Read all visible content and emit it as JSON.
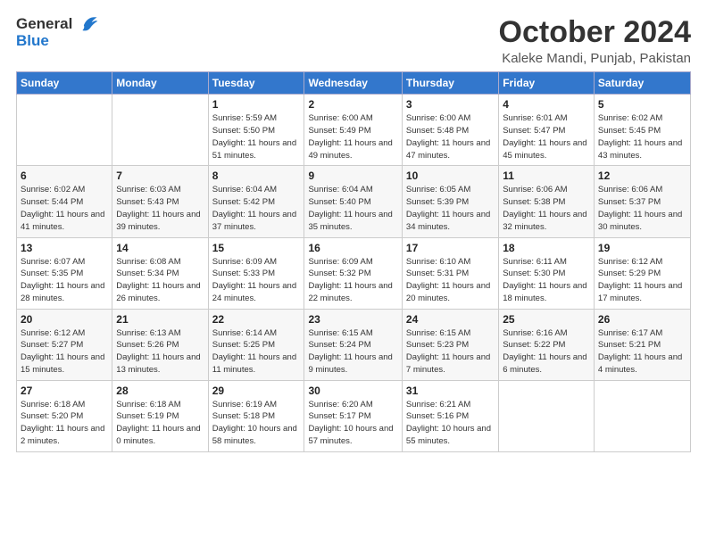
{
  "logo": {
    "general": "General",
    "blue": "Blue"
  },
  "title": "October 2024",
  "subtitle": "Kaleke Mandi, Punjab, Pakistan",
  "weekdays": [
    "Sunday",
    "Monday",
    "Tuesday",
    "Wednesday",
    "Thursday",
    "Friday",
    "Saturday"
  ],
  "weeks": [
    [
      {
        "day": "",
        "info": ""
      },
      {
        "day": "",
        "info": ""
      },
      {
        "day": "1",
        "info": "Sunrise: 5:59 AM\nSunset: 5:50 PM\nDaylight: 11 hours and 51 minutes."
      },
      {
        "day": "2",
        "info": "Sunrise: 6:00 AM\nSunset: 5:49 PM\nDaylight: 11 hours and 49 minutes."
      },
      {
        "day": "3",
        "info": "Sunrise: 6:00 AM\nSunset: 5:48 PM\nDaylight: 11 hours and 47 minutes."
      },
      {
        "day": "4",
        "info": "Sunrise: 6:01 AM\nSunset: 5:47 PM\nDaylight: 11 hours and 45 minutes."
      },
      {
        "day": "5",
        "info": "Sunrise: 6:02 AM\nSunset: 5:45 PM\nDaylight: 11 hours and 43 minutes."
      }
    ],
    [
      {
        "day": "6",
        "info": "Sunrise: 6:02 AM\nSunset: 5:44 PM\nDaylight: 11 hours and 41 minutes."
      },
      {
        "day": "7",
        "info": "Sunrise: 6:03 AM\nSunset: 5:43 PM\nDaylight: 11 hours and 39 minutes."
      },
      {
        "day": "8",
        "info": "Sunrise: 6:04 AM\nSunset: 5:42 PM\nDaylight: 11 hours and 37 minutes."
      },
      {
        "day": "9",
        "info": "Sunrise: 6:04 AM\nSunset: 5:40 PM\nDaylight: 11 hours and 35 minutes."
      },
      {
        "day": "10",
        "info": "Sunrise: 6:05 AM\nSunset: 5:39 PM\nDaylight: 11 hours and 34 minutes."
      },
      {
        "day": "11",
        "info": "Sunrise: 6:06 AM\nSunset: 5:38 PM\nDaylight: 11 hours and 32 minutes."
      },
      {
        "day": "12",
        "info": "Sunrise: 6:06 AM\nSunset: 5:37 PM\nDaylight: 11 hours and 30 minutes."
      }
    ],
    [
      {
        "day": "13",
        "info": "Sunrise: 6:07 AM\nSunset: 5:35 PM\nDaylight: 11 hours and 28 minutes."
      },
      {
        "day": "14",
        "info": "Sunrise: 6:08 AM\nSunset: 5:34 PM\nDaylight: 11 hours and 26 minutes."
      },
      {
        "day": "15",
        "info": "Sunrise: 6:09 AM\nSunset: 5:33 PM\nDaylight: 11 hours and 24 minutes."
      },
      {
        "day": "16",
        "info": "Sunrise: 6:09 AM\nSunset: 5:32 PM\nDaylight: 11 hours and 22 minutes."
      },
      {
        "day": "17",
        "info": "Sunrise: 6:10 AM\nSunset: 5:31 PM\nDaylight: 11 hours and 20 minutes."
      },
      {
        "day": "18",
        "info": "Sunrise: 6:11 AM\nSunset: 5:30 PM\nDaylight: 11 hours and 18 minutes."
      },
      {
        "day": "19",
        "info": "Sunrise: 6:12 AM\nSunset: 5:29 PM\nDaylight: 11 hours and 17 minutes."
      }
    ],
    [
      {
        "day": "20",
        "info": "Sunrise: 6:12 AM\nSunset: 5:27 PM\nDaylight: 11 hours and 15 minutes."
      },
      {
        "day": "21",
        "info": "Sunrise: 6:13 AM\nSunset: 5:26 PM\nDaylight: 11 hours and 13 minutes."
      },
      {
        "day": "22",
        "info": "Sunrise: 6:14 AM\nSunset: 5:25 PM\nDaylight: 11 hours and 11 minutes."
      },
      {
        "day": "23",
        "info": "Sunrise: 6:15 AM\nSunset: 5:24 PM\nDaylight: 11 hours and 9 minutes."
      },
      {
        "day": "24",
        "info": "Sunrise: 6:15 AM\nSunset: 5:23 PM\nDaylight: 11 hours and 7 minutes."
      },
      {
        "day": "25",
        "info": "Sunrise: 6:16 AM\nSunset: 5:22 PM\nDaylight: 11 hours and 6 minutes."
      },
      {
        "day": "26",
        "info": "Sunrise: 6:17 AM\nSunset: 5:21 PM\nDaylight: 11 hours and 4 minutes."
      }
    ],
    [
      {
        "day": "27",
        "info": "Sunrise: 6:18 AM\nSunset: 5:20 PM\nDaylight: 11 hours and 2 minutes."
      },
      {
        "day": "28",
        "info": "Sunrise: 6:18 AM\nSunset: 5:19 PM\nDaylight: 11 hours and 0 minutes."
      },
      {
        "day": "29",
        "info": "Sunrise: 6:19 AM\nSunset: 5:18 PM\nDaylight: 10 hours and 58 minutes."
      },
      {
        "day": "30",
        "info": "Sunrise: 6:20 AM\nSunset: 5:17 PM\nDaylight: 10 hours and 57 minutes."
      },
      {
        "day": "31",
        "info": "Sunrise: 6:21 AM\nSunset: 5:16 PM\nDaylight: 10 hours and 55 minutes."
      },
      {
        "day": "",
        "info": ""
      },
      {
        "day": "",
        "info": ""
      }
    ]
  ]
}
